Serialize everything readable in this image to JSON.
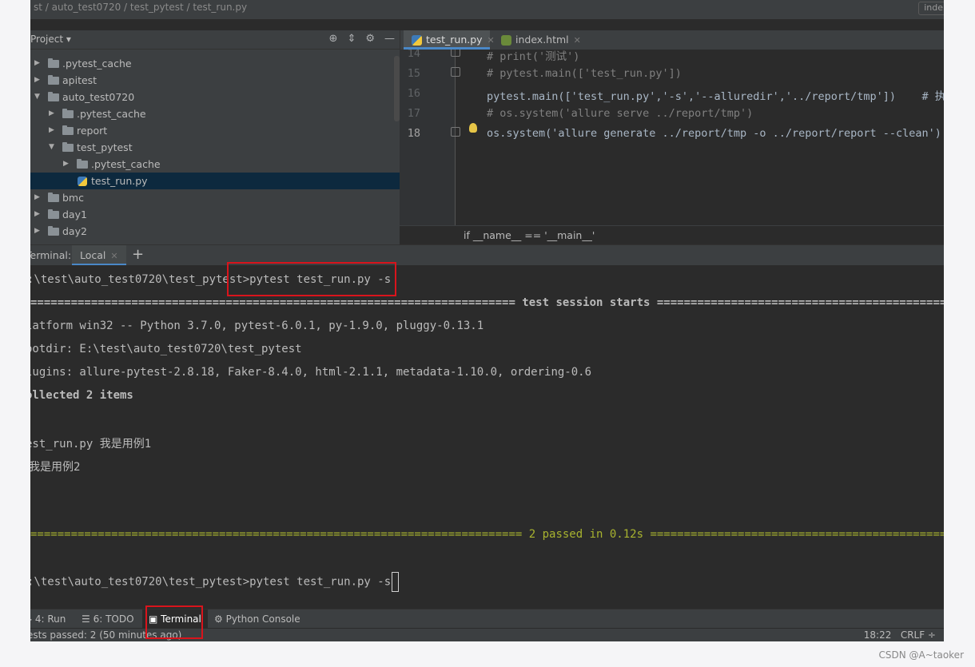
{
  "breadcrumb": {
    "path": "st  /  auto_test0720  /  test_pytest  /  test_run.py",
    "right_tab": "inde"
  },
  "project_panel": {
    "title": "Project",
    "tree": [
      {
        "label": ".pytest_cache",
        "depth": 0,
        "expanded": false,
        "type": "folder"
      },
      {
        "label": "apitest",
        "depth": 0,
        "expanded": false,
        "type": "folder"
      },
      {
        "label": "auto_test0720",
        "depth": 0,
        "expanded": true,
        "type": "folder"
      },
      {
        "label": ".pytest_cache",
        "depth": 1,
        "expanded": false,
        "type": "folder"
      },
      {
        "label": "report",
        "depth": 1,
        "expanded": false,
        "type": "folder"
      },
      {
        "label": "test_pytest",
        "depth": 1,
        "expanded": true,
        "type": "folder"
      },
      {
        "label": ".pytest_cache",
        "depth": 2,
        "expanded": false,
        "type": "folder"
      },
      {
        "label": "test_run.py",
        "depth": 2,
        "type": "py",
        "selected": true
      },
      {
        "label": "bmc",
        "depth": 0,
        "expanded": false,
        "type": "folder"
      },
      {
        "label": "day1",
        "depth": 0,
        "expanded": false,
        "type": "folder"
      },
      {
        "label": "day2",
        "depth": 0,
        "expanded": false,
        "type": "folder"
      }
    ]
  },
  "editor": {
    "tabs": [
      {
        "label": "test_run.py",
        "active": true
      },
      {
        "label": "index.html",
        "active": false
      }
    ],
    "lines": [
      {
        "num": "14",
        "text": "# print('测试')",
        "kind": "comment"
      },
      {
        "num": "15",
        "text": "# pytest.main(['test_run.py'])",
        "kind": "comment"
      },
      {
        "num": "16",
        "text": "pytest.main(['test_run.py','-s','--alluredir','../report/tmp'])    # 执行",
        "kind": "code"
      },
      {
        "num": "17",
        "text": "# os.system('allure serve ../report/tmp')",
        "kind": "comment"
      },
      {
        "num": "18",
        "text": "os.system('allure generate ../report/tmp -o ../report/report --clean')",
        "kind": "code"
      }
    ],
    "breadcrumb": "if __name__ == '__main__'"
  },
  "terminal": {
    "label": "Terminal:",
    "tab": "Local",
    "lines": [
      {
        "text": ":\\test\\auto_test0720\\test_pytest>pytest test_run.py -s",
        "style": "normal"
      },
      {
        "text": "======================================================================== test session starts =====================================================================",
        "style": "bold"
      },
      {
        "text": "latform win32 -- Python 3.7.0, pytest-6.0.1, py-1.9.0, pluggy-0.13.1",
        "style": "normal"
      },
      {
        "text": "ootdir: E:\\test\\auto_test0720\\test_pytest",
        "style": "normal"
      },
      {
        "text": "lugins: allure-pytest-2.8.18, Faker-8.4.0, html-2.1.1, metadata-1.10.0, ordering-0.6",
        "style": "normal"
      },
      {
        "text": "ollected 2 items",
        "style": "bold"
      },
      {
        "text": "est_run.py 我是用例1",
        "style": "normal"
      },
      {
        "text": "我是用例2",
        "style": "normal"
      },
      {
        "text": "========================================================================= 2 passed in 0.12s ======================================================================",
        "style": "green"
      },
      {
        "text": ":\\test\\auto_test0720\\test_pytest>pytest test_run.py -s",
        "style": "normal"
      }
    ]
  },
  "toolbar": {
    "items": [
      {
        "label": "4: Run",
        "icon": "run-icon"
      },
      {
        "label": "6: TODO",
        "icon": "todo-icon"
      },
      {
        "label": "Terminal",
        "icon": "terminal-icon",
        "active": true
      },
      {
        "label": "Python Console",
        "icon": "python-console-icon"
      }
    ]
  },
  "status": {
    "left": "ests passed: 2 (50 minutes ago)",
    "position": "18:22",
    "line_sep": "CRLF ÷"
  },
  "watermark": "CSDN @A~taoker"
}
